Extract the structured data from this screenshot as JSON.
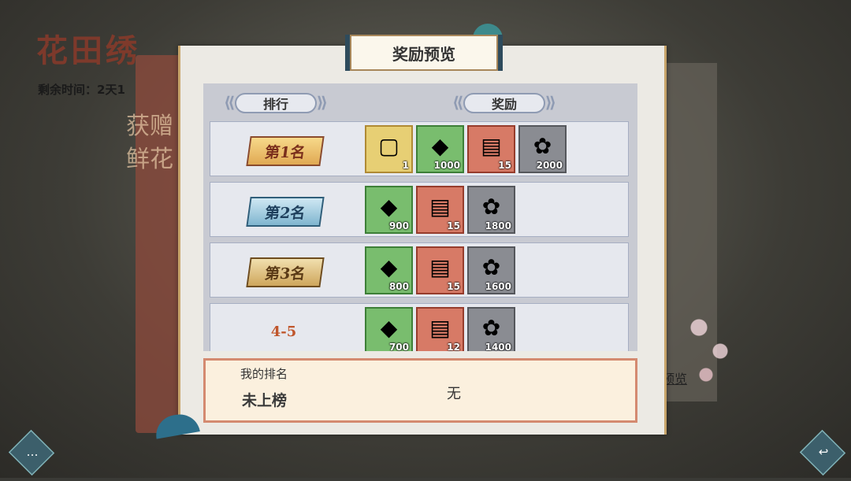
{
  "background": {
    "event_title": "花田绣",
    "time_left": "剩余时间：2天1",
    "vertical_text": "获赠鲜花",
    "preview_link": "预览"
  },
  "dialog": {
    "title": "奖励预览",
    "col_rank": "排行",
    "col_reward": "奖励",
    "rows": [
      {
        "rank": "第1名",
        "items": [
          {
            "icon": "frame-item",
            "qty": "1",
            "quality": "gold"
          },
          {
            "icon": "crystal",
            "qty": "1000",
            "quality": "green"
          },
          {
            "icon": "book",
            "qty": "15",
            "quality": "red"
          },
          {
            "icon": "lotus",
            "qty": "2000",
            "quality": "gray"
          }
        ]
      },
      {
        "rank": "第2名",
        "items": [
          {
            "icon": "crystal",
            "qty": "900",
            "quality": "green"
          },
          {
            "icon": "book",
            "qty": "15",
            "quality": "red"
          },
          {
            "icon": "lotus",
            "qty": "1800",
            "quality": "gray"
          }
        ]
      },
      {
        "rank": "第3名",
        "items": [
          {
            "icon": "crystal",
            "qty": "800",
            "quality": "green"
          },
          {
            "icon": "book",
            "qty": "15",
            "quality": "red"
          },
          {
            "icon": "lotus",
            "qty": "1600",
            "quality": "gray"
          }
        ]
      },
      {
        "rank": "4-5",
        "items": [
          {
            "icon": "crystal",
            "qty": "700",
            "quality": "green"
          },
          {
            "icon": "book",
            "qty": "12",
            "quality": "red"
          },
          {
            "icon": "lotus",
            "qty": "1400",
            "quality": "gray"
          }
        ]
      }
    ],
    "my_rank_label": "我的排名",
    "my_rank_value": "未上榜",
    "my_reward": "无"
  }
}
